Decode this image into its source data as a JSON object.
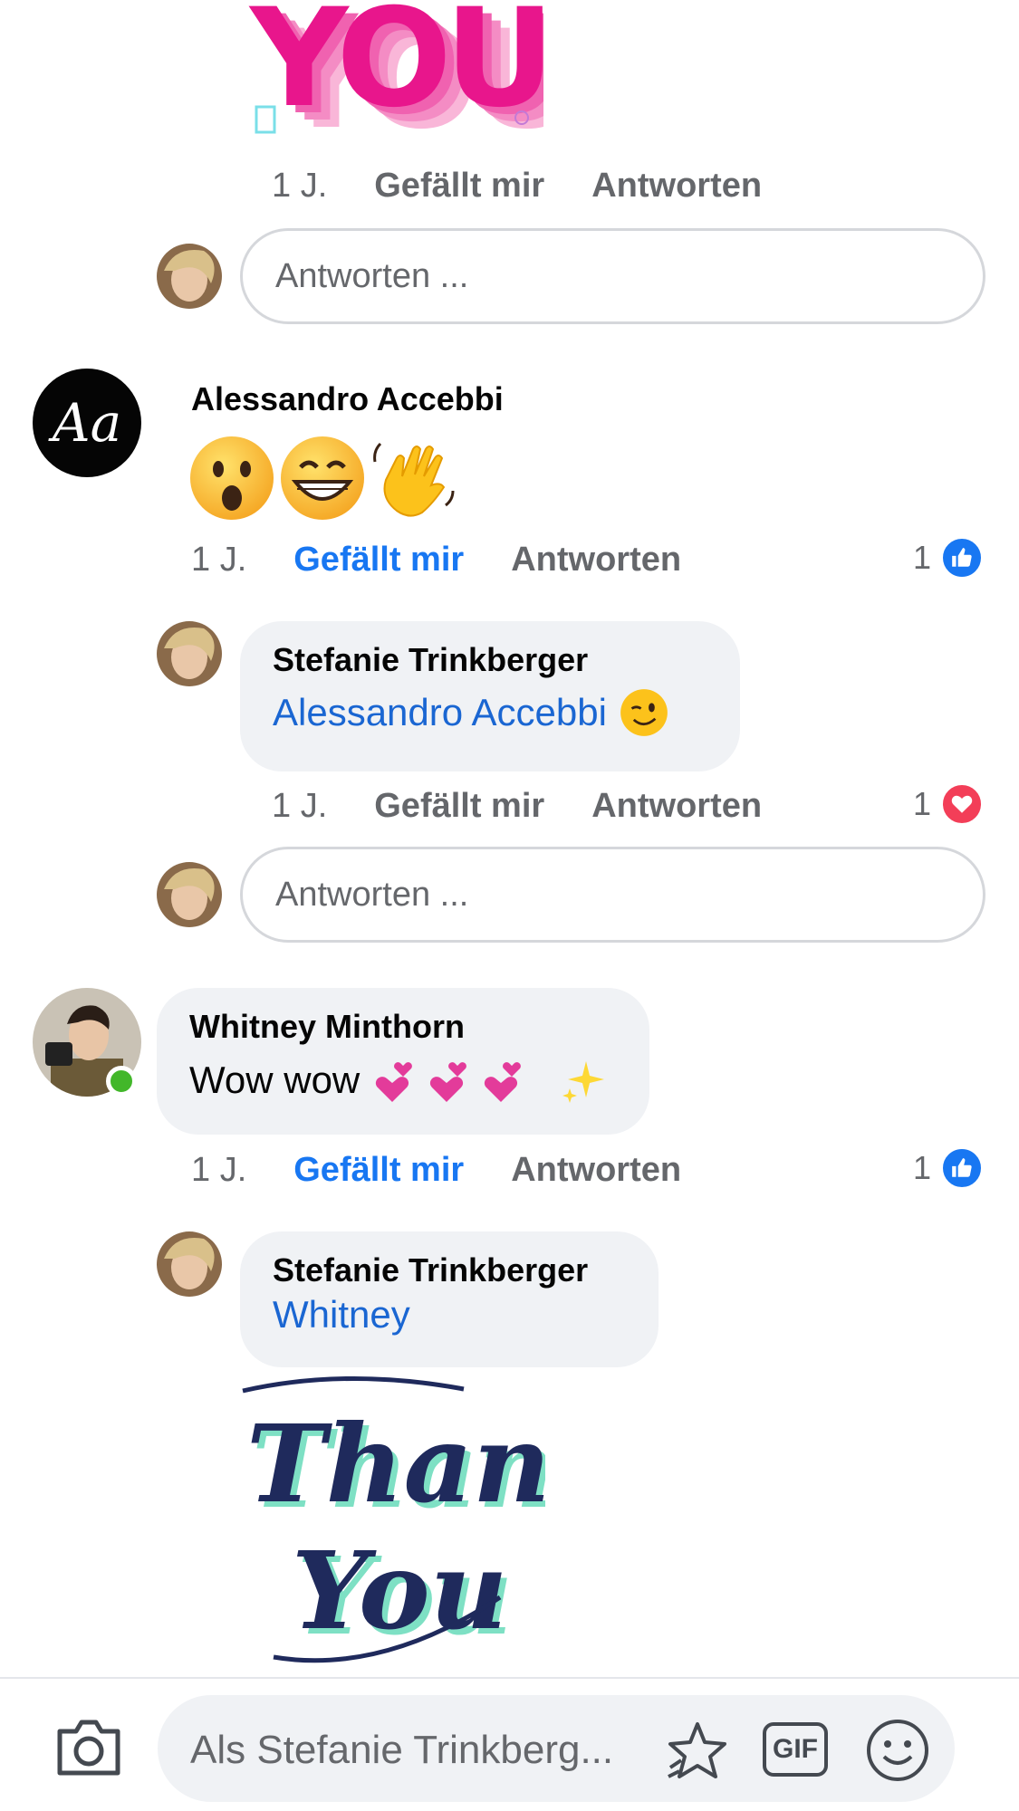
{
  "thread": {
    "reply1": {
      "time": "1 J.",
      "like": "Gefällt mir",
      "reply": "Antworten",
      "gif_text": "YOU"
    },
    "reply_input_1": {
      "placeholder": "Antworten ..."
    },
    "comment_alessandro": {
      "name": "Alessandro Accebbi",
      "avatar_text": "Aa",
      "time": "1 J.",
      "like": "Gefällt mir",
      "reply": "Antworten",
      "reaction_count": "1",
      "reaction": "like-icon"
    },
    "reply_stefanie_1": {
      "name": "Stefanie Trinkberger",
      "mention": "Alessandro Accebbi",
      "time": "1 J.",
      "like": "Gefällt mir",
      "reply": "Antworten",
      "reaction_count": "1",
      "reaction": "heart-icon"
    },
    "reply_input_2": {
      "placeholder": "Antworten ..."
    },
    "comment_whitney": {
      "name": "Whitney Minthorn",
      "text": "Wow wow",
      "time": "1 J.",
      "like": "Gefällt mir",
      "reply": "Antworten",
      "reaction_count": "1",
      "reaction": "like-icon"
    },
    "reply_stefanie_2": {
      "name": "Stefanie Trinkberger",
      "mention": "Whitney",
      "sticker_text_1": "Thank",
      "sticker_text_2": "You"
    }
  },
  "composer": {
    "placeholder": "Als Stefanie Trinkberg...",
    "gif_label": "GIF",
    "icons": [
      "camera-icon",
      "sticker-icon",
      "gif-icon",
      "emoji-icon"
    ]
  },
  "colors": {
    "accent": "#1877f2",
    "mention": "#1a66d2",
    "heart": "#f33e58",
    "bubble": "#f0f2f5",
    "you_pink": "#e8168c"
  }
}
